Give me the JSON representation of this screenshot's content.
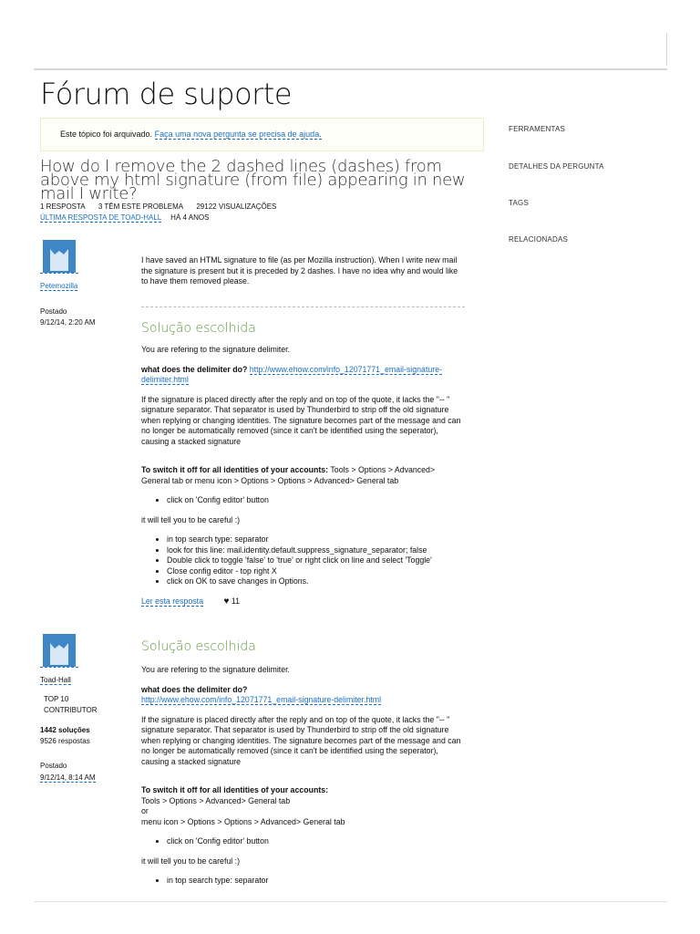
{
  "page_title": "Fórum de suporte",
  "archived": {
    "text": "Este tópico foi arquivado.",
    "link": "Faça uma nova pergunta se precisa de ajuda."
  },
  "question": {
    "title": "How do I remove the 2 dashed lines (dashes) from above my html signature (from file) appearing in new mail I write?",
    "replies": "1 resposta",
    "have_problem": "3 têm este problema",
    "views": "29122 visualizações",
    "last_reply": "Última resposta de Toad-Hall",
    "ago": "há 4 anos"
  },
  "sidebar": {
    "items": [
      "Ferramentas",
      "Detalhes da pergunta",
      "Tags",
      "Relacionadas"
    ]
  },
  "post1": {
    "author": "Petemozilla",
    "posted_label": "Postado",
    "posted_date": "9/12/14, 2:20 AM",
    "body": "I have saved an HTML signature to file (as per Mozilla instruction). When I write new mail the signature is present but it is preceded by 2 dashes. I have no idea why and would like to have them removed please."
  },
  "solution1": {
    "heading": "Solução escolhida",
    "p1": "You are refering to the signature delimiter.",
    "q_label": "what does the delimiter do?",
    "url": "http://www.ehow.com/info_12071771_email-signature-delimiter.html",
    "p2": "If the signature is placed directly after the reply and on top of the quote, it lacks the \"-- \" signature separator. That separator is used by Thunderbird to strip off the old signature when replying or changing identities. The signature becomes part of the message and can no longer be automatically removed (since it can't be identified using the seperator), causing a stacked signature",
    "switch_label": "To switch it off for all identities of your accounts:",
    "switch_path": "Tools > Options > Advanced> General tab or menu icon > Options > Options > Advanced> General tab",
    "bullet_a": "click on 'Config editor' button",
    "careful": "it will tell you to be careful :)",
    "bullets_b": [
      "in top search type: separator",
      "look for this line: mail.identity.default.suppress_signature_separator; false",
      "Double click to toggle 'false' to 'true' or right click on line and select 'Toggle'",
      "Close config editor - top right X",
      "click on OK to save changes in Options."
    ],
    "read_link": "Ler esta resposta",
    "likes": "11"
  },
  "post2": {
    "author": "Toad-Hall",
    "rank1": "TOP 10",
    "rank2": "CONTRIBUTOR",
    "solutions": "1442 soluções",
    "answers": "9526 respostas",
    "posted_label": "Postado",
    "posted_date": "9/12/14, 8:14 AM"
  },
  "solution2": {
    "heading": "Solução escolhida",
    "p1": "You are refering to the signature delimiter.",
    "q_label": "what does the delimiter do?",
    "url": "http://www.ehow.com/info_12071771_email-signature-delimiter.html",
    "p2": "If the signature is placed directly after the reply and on top of the quote, it lacks the \"-- \" signature separator. That separator is used by Thunderbird to strip off the old signature when replying or changing identities. The signature becomes part of the message and can no longer be automatically removed (since it can't be identified using the seperator), causing a stacked signature",
    "switch_label": "To switch it off for all identities of your accounts:",
    "line1": "Tools > Options > Advanced> General tab",
    "line2": "or",
    "line3": "menu icon > Options > Options > Advanced> General tab",
    "bullet_a": "click on 'Config editor' button",
    "careful": "it will tell you to be careful :)",
    "bullet_b": "in top search type: separator"
  }
}
